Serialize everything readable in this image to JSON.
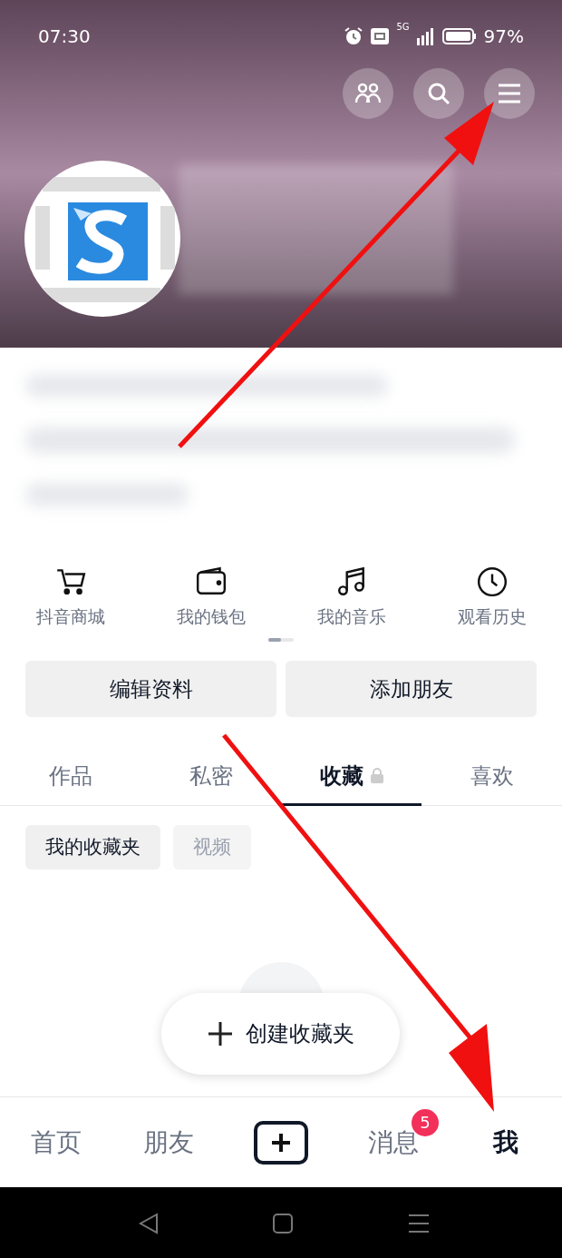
{
  "status_bar": {
    "time": "07:30",
    "network": "5G",
    "battery": "97%"
  },
  "shortcuts": [
    {
      "kind": "cart",
      "label": "抖音商城"
    },
    {
      "kind": "wallet",
      "label": "我的钱包"
    },
    {
      "kind": "music",
      "label": "我的音乐"
    },
    {
      "kind": "clock",
      "label": "观看历史"
    }
  ],
  "actions": [
    "编辑资料",
    "添加朋友"
  ],
  "tabs": [
    {
      "label": "作品",
      "selected": false,
      "locked": false
    },
    {
      "label": "私密",
      "selected": false,
      "locked": false
    },
    {
      "label": "收藏",
      "selected": true,
      "locked": true
    },
    {
      "label": "喜欢",
      "selected": false,
      "locked": false
    }
  ],
  "chips": [
    {
      "label": "我的收藏夹",
      "selected": true
    },
    {
      "label": "视频",
      "selected": false
    }
  ],
  "create_button": "创建收藏夹",
  "bottom_nav": [
    {
      "kind": "text",
      "label": "首页",
      "selected": false
    },
    {
      "kind": "text",
      "label": "朋友",
      "selected": false
    },
    {
      "kind": "plus",
      "selected": false
    },
    {
      "kind": "text",
      "label": "消息",
      "selected": false,
      "badge": "5"
    },
    {
      "kind": "text",
      "label": "我",
      "selected": true
    }
  ]
}
